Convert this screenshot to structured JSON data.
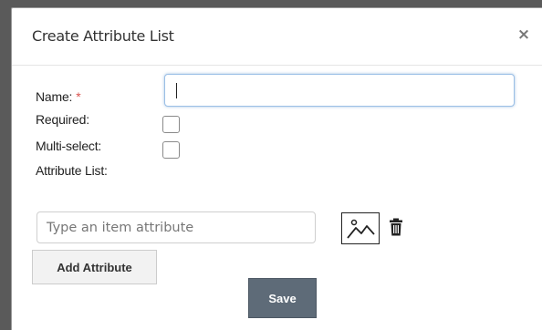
{
  "dialog": {
    "title": "Create Attribute List",
    "close_symbol": "×"
  },
  "form": {
    "name_label": "Name:",
    "required_marker": "*",
    "name_value": "",
    "required_label": "Required:",
    "required_checked": false,
    "multiselect_label": "Multi-select:",
    "multiselect_checked": false,
    "attribute_list_label": "Attribute List:"
  },
  "attribute_row": {
    "placeholder": "Type an item attribute",
    "value": "",
    "image_icon": "image-icon",
    "delete_icon": "trash-icon"
  },
  "buttons": {
    "add_attribute": "Add Attribute",
    "save": "Save"
  },
  "colors": {
    "required_marker": "#d9534f",
    "save_button": "#5e6b78",
    "focus_border": "#9bbfe6"
  }
}
